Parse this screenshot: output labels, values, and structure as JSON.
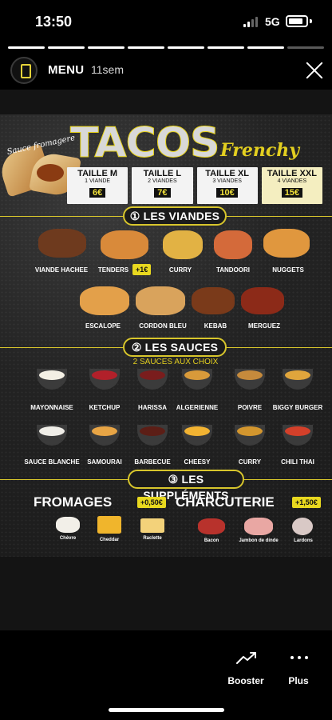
{
  "status_bar": {
    "time": "13:50",
    "network": "5G"
  },
  "story_header": {
    "account": "MENU",
    "age": "11sem"
  },
  "poster": {
    "sauce_label": "Sauce fromagere",
    "logo": "TACOS",
    "logo_sub": "Frenchy",
    "sizes": [
      {
        "name": "TAILLE M",
        "meats": "1 VIANDE",
        "price": "6€"
      },
      {
        "name": "TAILLE L",
        "meats": "2 VIANDES",
        "price": "7€"
      },
      {
        "name": "TAILLE XL",
        "meats": "3 VIANDES",
        "price": "10€"
      },
      {
        "name": "TAILLE XXL",
        "meats": "4 VIANDES",
        "price": "15€"
      }
    ],
    "sections": {
      "viandes": "① LES VIANDES",
      "sauces": "② LES SAUCES",
      "sauces_sub": "2 SAUCES AUX CHOIX",
      "supplements": "③ LES SUPPLÉMENTS"
    },
    "meats": [
      "VIANDE HACHEE",
      "TENDERS",
      "CURRY",
      "TANDOORI",
      "NUGGETS",
      "ESCALOPE",
      "CORDON BLEU",
      "KEBAB",
      "MERGUEZ"
    ],
    "tenders_extra": "+1€",
    "sauces": [
      "MAYONNAISE",
      "KETCHUP",
      "HARISSA",
      "ALGERIENNE",
      "POIVRE",
      "BIGGY BURGER",
      "SAUCE BLANCHE",
      "SAMOURAI",
      "BARBECUE",
      "CHEESY",
      "CURRY",
      "CHILI THAI"
    ],
    "sauce_colors": [
      "#f3efe4",
      "#b1202a",
      "#7a1d1d",
      "#d89a3a",
      "#c58a3c",
      "#e0a53c",
      "#f0eee8",
      "#e8a545",
      "#5c1e16",
      "#f2b332",
      "#d3962e",
      "#d4402a"
    ],
    "fromages": {
      "title": "FROMAGES",
      "price": "+0,50€",
      "items": [
        "Chèvre",
        "Cheddar",
        "Raclette"
      ]
    },
    "charcuterie": {
      "title": "CHARCUTERIE",
      "price": "+1,50€",
      "items": [
        "Bacon",
        "Jambon de dinde",
        "Lardons"
      ]
    }
  },
  "actions": {
    "boost": "Booster",
    "more": "Plus"
  }
}
